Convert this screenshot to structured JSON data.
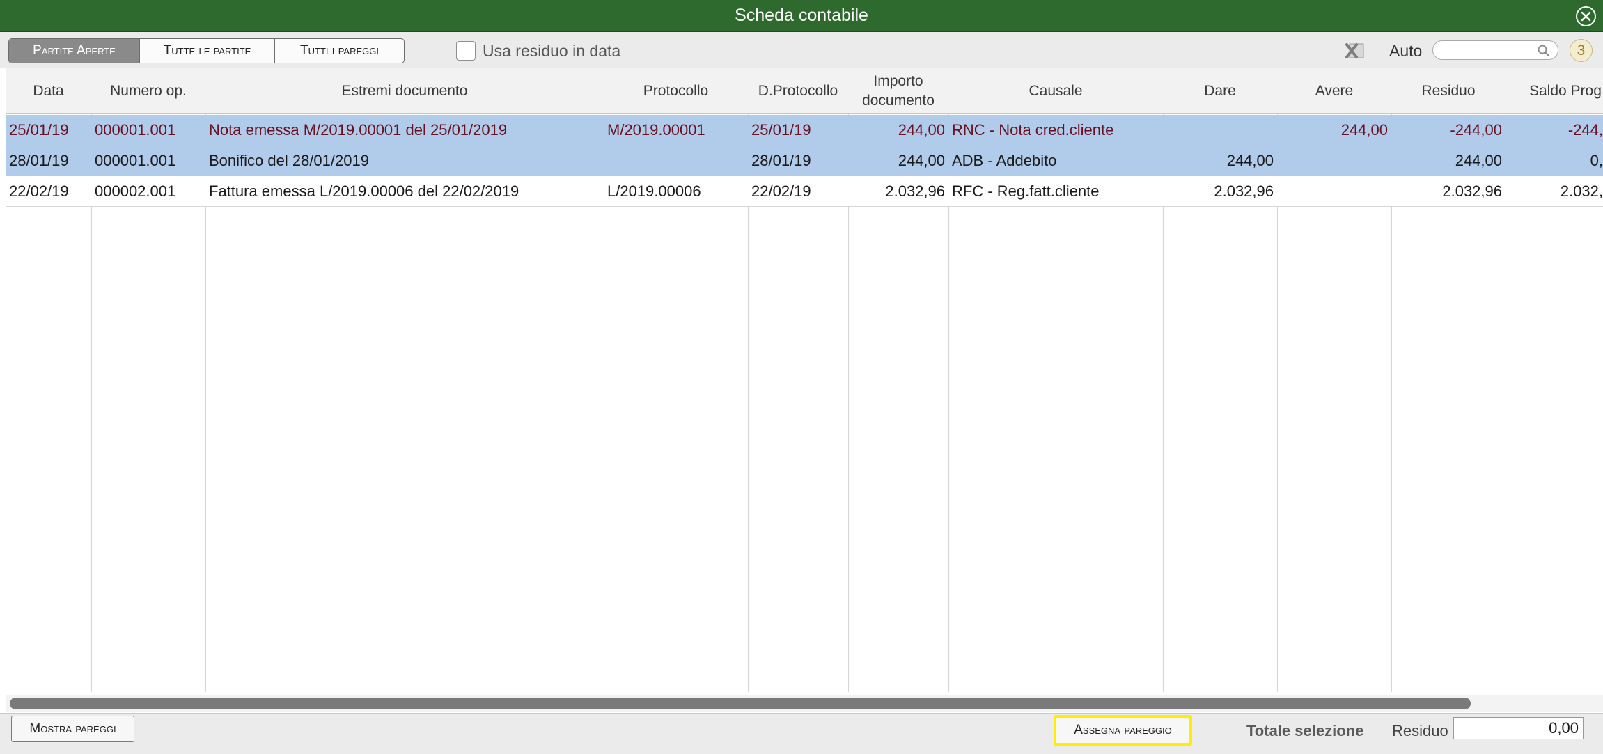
{
  "window": {
    "title": "Scheda contabile"
  },
  "toolbar": {
    "tabs": [
      {
        "label": "Partite Aperte",
        "active": true
      },
      {
        "label": "Tutte le partite",
        "active": false
      },
      {
        "label": "Tutti i pareggi",
        "active": false
      }
    ],
    "checkbox_label": "Usa residuo in data",
    "checkbox_checked": false,
    "auto_label": "Auto",
    "search_value": "",
    "count_badge": "3"
  },
  "table": {
    "columns": [
      "Data",
      "Numero op.",
      "Estremi documento",
      "Protocollo",
      "D.Protocollo",
      "Importo documento",
      "Causale",
      "Dare",
      "Avere",
      "Residuo",
      "Saldo Prog"
    ],
    "rows": [
      {
        "data": "25/01/19",
        "numero": "000001.001",
        "estremi": "Nota emessa M/2019.00001 del 25/01/2019",
        "protocollo": "M/2019.00001",
        "dprot": "25/01/19",
        "importo": "244,00",
        "causale": "RNC - Nota cred.cliente",
        "dare": "",
        "avere": "244,00",
        "residuo": "-244,00",
        "saldo": "-244,"
      },
      {
        "data": "28/01/19",
        "numero": "000001.001",
        "estremi": "Bonifico del 28/01/2019",
        "protocollo": "",
        "dprot": "28/01/19",
        "importo": "244,00",
        "causale": "ADB - Addebito",
        "dare": "244,00",
        "avere": "",
        "residuo": "244,00",
        "saldo": "0,"
      },
      {
        "data": "22/02/19",
        "numero": "000002.001",
        "estremi": "Fattura emessa L/2019.00006 del 22/02/2019",
        "protocollo": "L/2019.00006",
        "dprot": "22/02/19",
        "importo": "2.032,96",
        "causale": "RFC - Reg.fatt.cliente",
        "dare": "2.032,96",
        "avere": "",
        "residuo": "2.032,96",
        "saldo": "2.032,"
      }
    ]
  },
  "footer": {
    "mostra_label": "Mostra pareggi",
    "assegna_label": "Assegna pareggio",
    "totale_label": "Totale selezione",
    "residuo_label": "Residuo",
    "residuo_value": "0,00"
  },
  "colors": {
    "titlebar": "#2e6a2e",
    "selection": "#b1cbeb",
    "highlight_border": "#ffee00",
    "red_text": "#6b1021"
  }
}
